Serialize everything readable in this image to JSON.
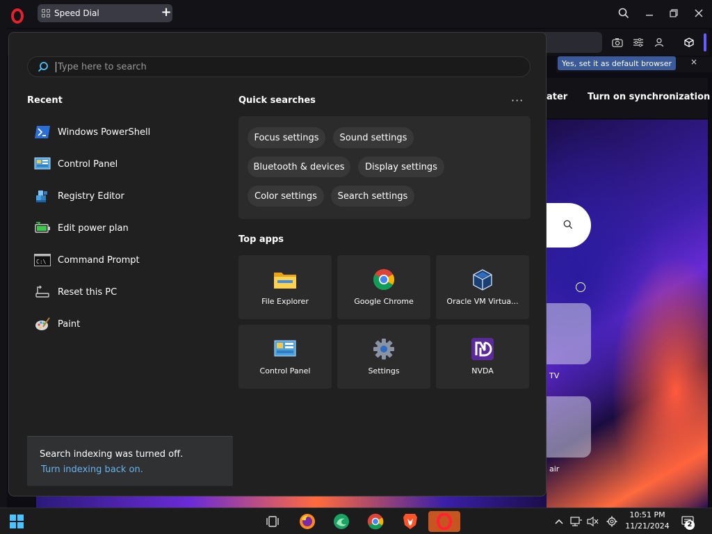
{
  "browser": {
    "tab_label": "Speed Dial",
    "default_browser_button": "Yes, set it as default browser",
    "default_close": "×",
    "nav_later": "ater",
    "nav_sync": "Turn on synchronization",
    "wallpaper_tile_1": "TV",
    "wallpaper_tile_2": "air"
  },
  "search": {
    "placeholder": "Type here to search"
  },
  "recent": {
    "title": "Recent",
    "items": [
      {
        "label": "Windows PowerShell",
        "icon": "powershell-icon"
      },
      {
        "label": "Control Panel",
        "icon": "control-panel-icon"
      },
      {
        "label": "Registry Editor",
        "icon": "registry-editor-icon"
      },
      {
        "label": "Edit power plan",
        "icon": "battery-icon"
      },
      {
        "label": "Command Prompt",
        "icon": "command-prompt-icon"
      },
      {
        "label": "Reset this PC",
        "icon": "reset-pc-icon"
      },
      {
        "label": "Paint",
        "icon": "paint-icon"
      }
    ]
  },
  "quick_searches": {
    "title": "Quick searches",
    "more": "···",
    "chips": [
      "Focus settings",
      "Sound settings",
      "Bluetooth & devices",
      "Display settings",
      "Color settings",
      "Search settings"
    ]
  },
  "top_apps": {
    "title": "Top apps",
    "apps": [
      {
        "label": "File Explorer",
        "icon": "folder-icon"
      },
      {
        "label": "Google Chrome",
        "icon": "chrome-icon"
      },
      {
        "label": "Oracle VM Virtua...",
        "icon": "virtualbox-icon"
      },
      {
        "label": "Control Panel",
        "icon": "control-panel-icon"
      },
      {
        "label": "Settings",
        "icon": "gear-icon"
      },
      {
        "label": "NVDA",
        "icon": "nvda-icon"
      }
    ]
  },
  "indexing": {
    "message": "Search indexing was turned off.",
    "link": "Turn indexing back on."
  },
  "taskbar": {
    "time": "10:51 PM",
    "date": "11/21/2024",
    "notification_count": "2"
  },
  "colors": {
    "accent_link": "#68b5f0",
    "panel_bg": "#202020",
    "active_app": "#c6551f",
    "opera_red": "#e3222e"
  }
}
